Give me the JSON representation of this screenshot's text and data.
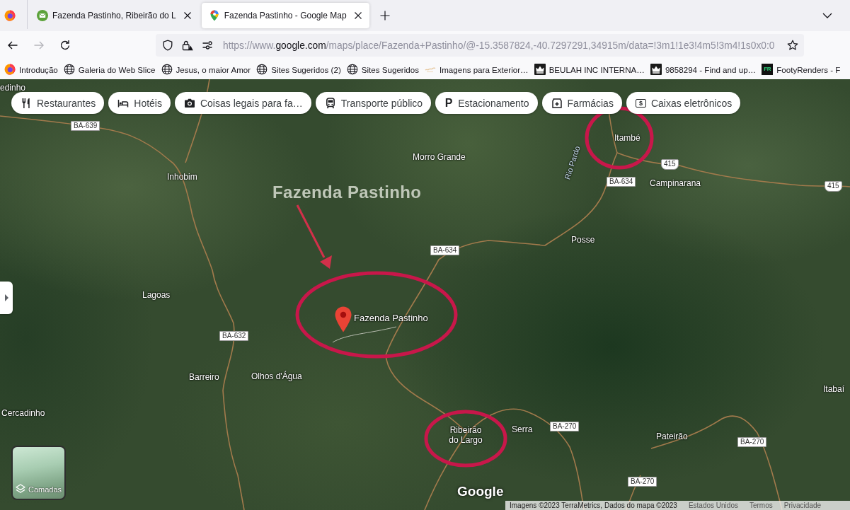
{
  "browser": {
    "tabs": [
      {
        "title": "Fazenda Pastinho, Ribeirão do L",
        "selected": false
      },
      {
        "title": "Fazenda Pastinho - Google Map",
        "selected": true
      }
    ],
    "nav_buttons": [
      {
        "kind": "back",
        "disabled": false
      },
      {
        "kind": "forward",
        "disabled": true
      },
      {
        "kind": "reload",
        "disabled": false
      }
    ],
    "url": {
      "prefix": "https://www.",
      "domain": "google.com",
      "path": "/maps/place/Fazenda+Pastinho/@-15.3587824,-40.7297291,34915m/data=!3m1!1e3!4m5!3m4!1s0x0:0"
    },
    "bookmarks": [
      {
        "label": "Introdução"
      },
      {
        "label": "Galeria do Web Slice"
      },
      {
        "label": "Jesus, o maior Amor"
      },
      {
        "label": "Sites Sugeridos (2)"
      },
      {
        "label": "Sites Sugeridos"
      },
      {
        "label": "Imagens para Exterior…"
      },
      {
        "label": "BEULAH INC INTERNA…"
      },
      {
        "label": "9858294 - Find and up…"
      },
      {
        "label": "FootyRenders - F",
        "icon_text": "FR"
      }
    ]
  },
  "map": {
    "categories": [
      {
        "label": "Restaurantes"
      },
      {
        "label": "Hotéis"
      },
      {
        "label": "Coisas legais para fa…"
      },
      {
        "label": "Transporte público"
      },
      {
        "label": "Estacionamento",
        "icon_text": "P"
      },
      {
        "label": "Farmácias"
      },
      {
        "label": "Caixas eletrônicos",
        "icon_text": "$"
      }
    ],
    "place_labels": [
      {
        "text": "edinho",
        "kind": "town"
      },
      {
        "text": "Itambé",
        "kind": "town"
      },
      {
        "text": "Morro Grande",
        "kind": "town"
      },
      {
        "text": "Rio Pardo",
        "kind": "river"
      },
      {
        "text": "Inhobim",
        "kind": "town"
      },
      {
        "text": "Campinarana",
        "kind": "town"
      },
      {
        "text": "Posse",
        "kind": "town"
      },
      {
        "text": "Lagoas",
        "kind": "town"
      },
      {
        "text": "Barreiro",
        "kind": "town"
      },
      {
        "text": "Olhos d'Água",
        "kind": "town"
      },
      {
        "text": "Itabaí",
        "kind": "town"
      },
      {
        "text": "Cercadinho",
        "kind": "town"
      },
      {
        "text": "Serra",
        "kind": "town"
      },
      {
        "text": "Ribeirão do Largo",
        "kind": "town"
      },
      {
        "text": "Pateirão",
        "kind": "town"
      }
    ],
    "road_shields": [
      {
        "text": "BA-639",
        "kind": "state"
      },
      {
        "text": "415",
        "kind": "federal"
      },
      {
        "text": "BA-634",
        "kind": "state"
      },
      {
        "text": "415",
        "kind": "federal"
      },
      {
        "text": "BA-634",
        "kind": "state"
      },
      {
        "text": "BA-632",
        "kind": "state"
      },
      {
        "text": "BA-270",
        "kind": "state"
      },
      {
        "text": "BA-270",
        "kind": "state"
      },
      {
        "text": "BA-270",
        "kind": "state"
      }
    ],
    "marker": {
      "label": "Fazenda Pastinho"
    },
    "layers_button": {
      "label": "Camadas"
    },
    "logo": "Google",
    "attribution": [
      {
        "text": "Imagens ©2023 TerraMetrics, Dados do mapa ©2023",
        "kind": "credit"
      },
      {
        "text": "Estados Unidos",
        "kind": "link"
      },
      {
        "text": "Termos",
        "kind": "link"
      },
      {
        "text": "Privacidade",
        "kind": "link"
      }
    ]
  },
  "annotation": {
    "title": "Fazenda Pastinho"
  }
}
